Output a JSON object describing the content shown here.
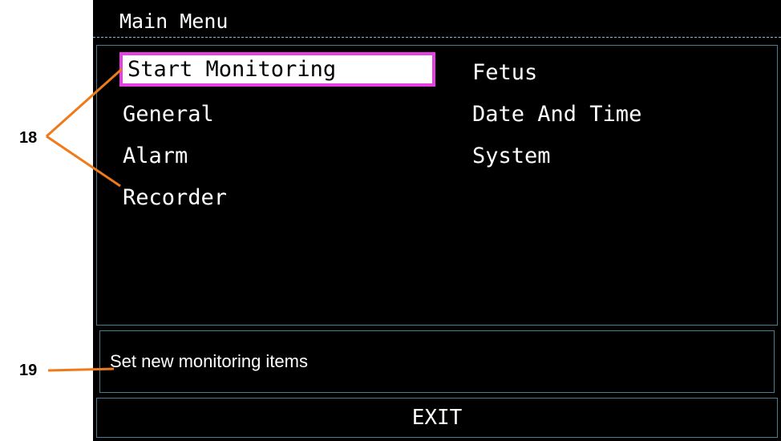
{
  "header": {
    "title": "Main Menu"
  },
  "menu": {
    "items": [
      {
        "label": "Start Monitoring",
        "selected": true
      },
      {
        "label": "General",
        "selected": false
      },
      {
        "label": "Alarm",
        "selected": false
      },
      {
        "label": "Recorder",
        "selected": false
      },
      {
        "label": "Fetus",
        "selected": false
      },
      {
        "label": "Date And Time",
        "selected": false
      },
      {
        "label": "System",
        "selected": false
      }
    ]
  },
  "help": {
    "text": "Set new monitoring items"
  },
  "footer": {
    "exit_label": "EXIT"
  },
  "callouts": {
    "menu_items_label": "18",
    "help_text_label": "19"
  },
  "colors": {
    "screen_background": "#000000",
    "text": "#ffffff",
    "selection_border": "#e63fe3",
    "panel_border": "#4c7c91",
    "callout_line": "#f07a1a"
  }
}
